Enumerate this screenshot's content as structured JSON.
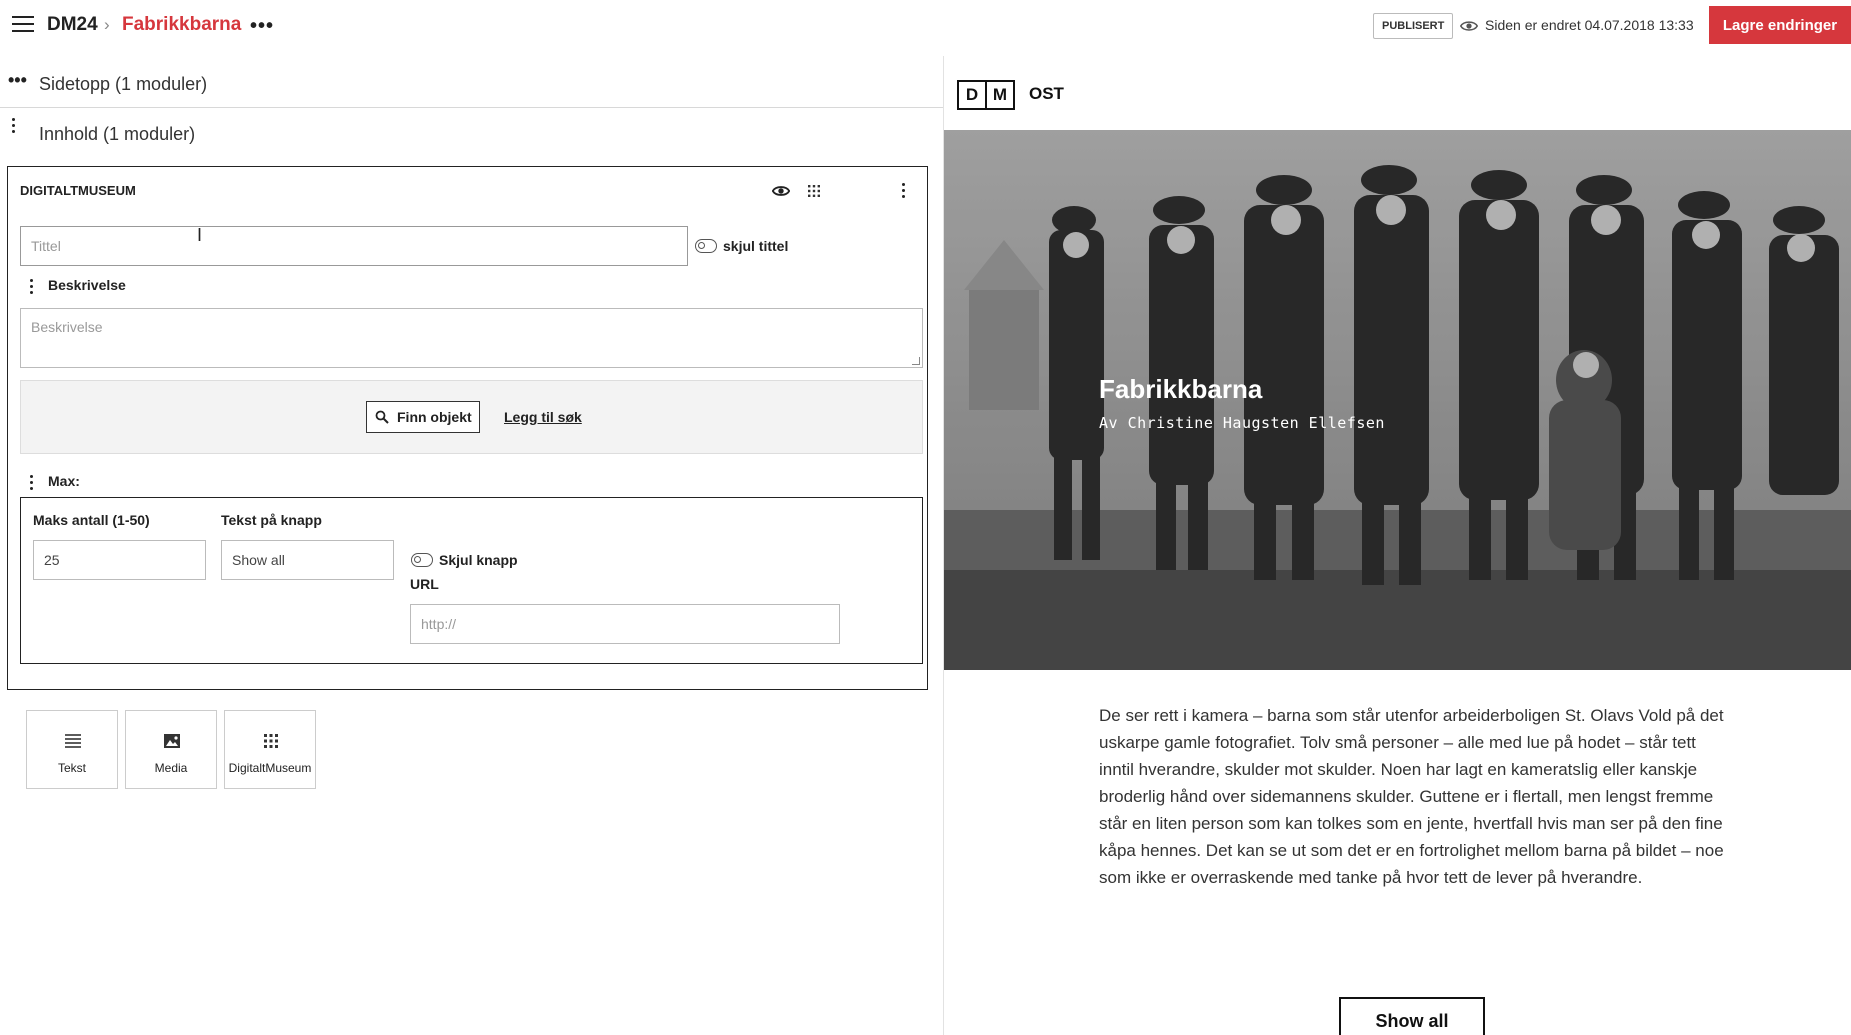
{
  "header": {
    "root_crumb": "DM24",
    "crumb_separator": "›",
    "page_crumb": "Fabrikkbarna",
    "status_badge": "PUBLISERT",
    "changed_text": "Siden er endret 04.07.2018 13:33",
    "save_label": "Lagre endringer",
    "accent_color": "#d6373d"
  },
  "sections": [
    {
      "label": "Sidetopp (1 moduler)"
    },
    {
      "label": "Innhold (1 moduler)"
    }
  ],
  "module": {
    "title": "DIGITALTMUSEUM",
    "title_placeholder": "Tittel",
    "hide_title_label": "skjul tittel",
    "description_label": "Beskrivelse",
    "description_placeholder": "Beskrivelse",
    "find_button": "Finn objekt",
    "add_search_link": "Legg til søk",
    "max_label": "Max:",
    "max_count_label": "Maks antall (1-50)",
    "max_count_value": "25",
    "button_text_label": "Tekst på knapp",
    "button_text_value": "Show all",
    "hide_button_label": "Skjul knapp",
    "url_label": "URL",
    "url_placeholder": "http://"
  },
  "add_tiles": [
    {
      "label": "Tekst",
      "icon": "text-lines-icon"
    },
    {
      "label": "Media",
      "icon": "image-icon"
    },
    {
      "label": "DigitaltMuseum",
      "icon": "grid-icon"
    }
  ],
  "preview": {
    "logo_letters": [
      "D",
      "M"
    ],
    "logo_suffix": "OST",
    "hero_title": "Fabrikkbarna",
    "hero_byline": "Av Christine Haugsten Ellefsen",
    "body": "De ser rett i kamera – barna som står utenfor arbeiderboligen St. Olavs Vold på det uskarpe gamle fotografiet. Tolv små personer – alle med lue på hodet – står tett inntil hverandre, skulder mot skulder. Noen har lagt en kameratslig eller kanskje broderlig hånd over sidemannens skulder. Guttene er i flertall, men lengst fremme står en liten person som kan tolkes som en jente, hvertfall hvis man ser på den fine kåpa hennes. Det kan se ut som det er en fortrolighet mellom barna på bildet – noe som ikke er overraskende med tanke på hvor tett de lever på hverandre.",
    "show_all_button": "Show all"
  }
}
